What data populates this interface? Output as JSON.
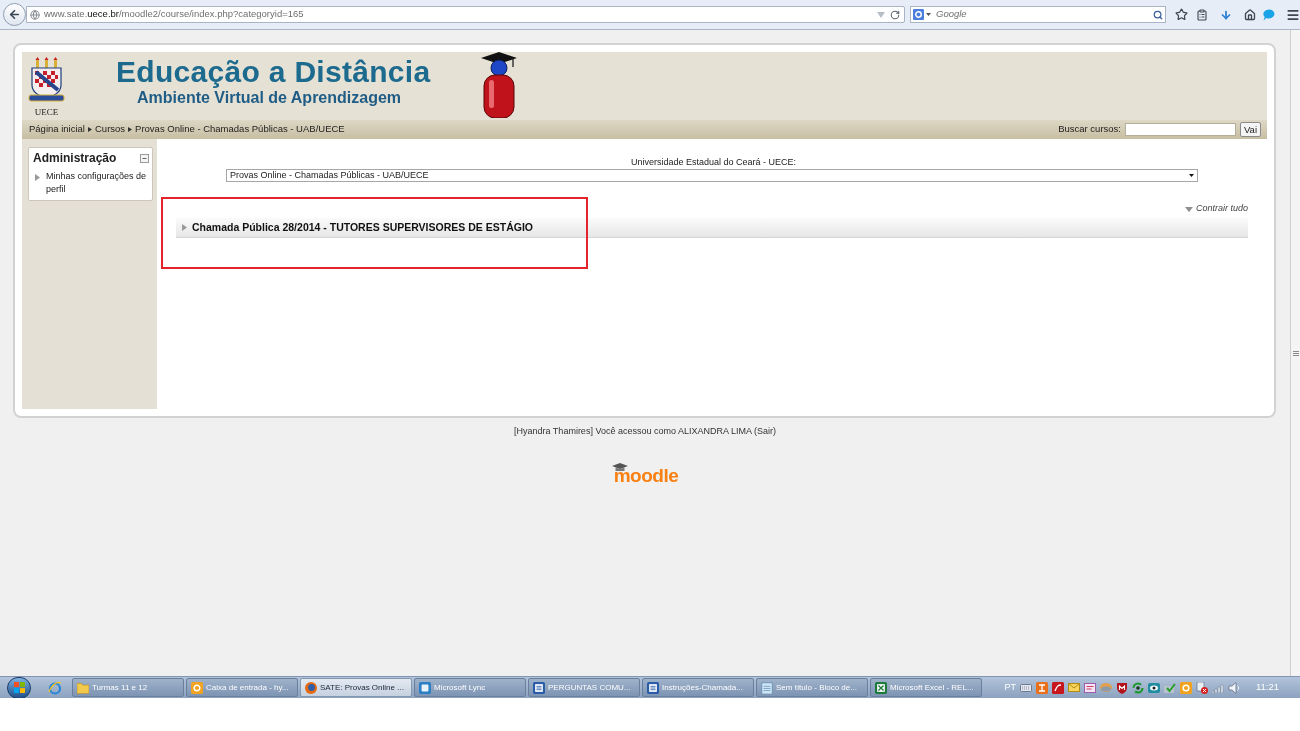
{
  "browser": {
    "url": {
      "prefix": "www.sate.",
      "domain": "uece.br",
      "path": "/moodle2/course/index.php?categoryid=165"
    },
    "search": {
      "placeholder": "Google"
    }
  },
  "header": {
    "logo_caption": "UECE",
    "title": "Educação a Distância",
    "subtitle": "Ambiente Virtual de Aprendizagem"
  },
  "breadcrumb": [
    "Página inicial",
    "Cursos",
    "Provas Online - Chamadas Públicas - UAB/UECE"
  ],
  "course_search": {
    "label": "Buscar cursos:",
    "button": "Vai"
  },
  "admin_block": {
    "title": "Administração",
    "items": [
      {
        "label": "Minhas configurações de perfil",
        "expanded": false
      }
    ]
  },
  "category_jump": {
    "label": "Universidade Estadual do Ceará - UECE:",
    "value": "Provas Online - Chamadas Públicas - UAB/UECE"
  },
  "collapse_all": "Contrair tudo",
  "categories": [
    {
      "name": "Chamada Pública 28/2014 - TUTORES SUPERVISORES DE ESTÁGIO",
      "expanded": false,
      "highlighted": true
    }
  ],
  "footer": {
    "login_info": "[Hyandra Thamires] Você acessou como ALIXANDRA LIMA (Sair)",
    "logo": "moodle"
  },
  "taskbar": {
    "items": [
      {
        "label": "Turmas 11 e 12",
        "kind": "folder",
        "selected": false
      },
      {
        "label": "Caixa de entrada - hy...",
        "kind": "mail",
        "selected": false
      },
      {
        "label": "SATE: Provas Online ...",
        "kind": "browser",
        "selected": true
      },
      {
        "label": "Microsoft Lync",
        "kind": "chat",
        "selected": false
      },
      {
        "label": "PERGUNTAS COMU...",
        "kind": "document",
        "selected": false
      },
      {
        "label": "Instruções-Chamada...",
        "kind": "document",
        "selected": false
      },
      {
        "label": "Sem título - Bloco de...",
        "kind": "notepad",
        "selected": false
      },
      {
        "label": "Microsoft Excel - REL...",
        "kind": "spreadsheet",
        "selected": false
      }
    ],
    "language": "PT",
    "clock": "11:21"
  }
}
